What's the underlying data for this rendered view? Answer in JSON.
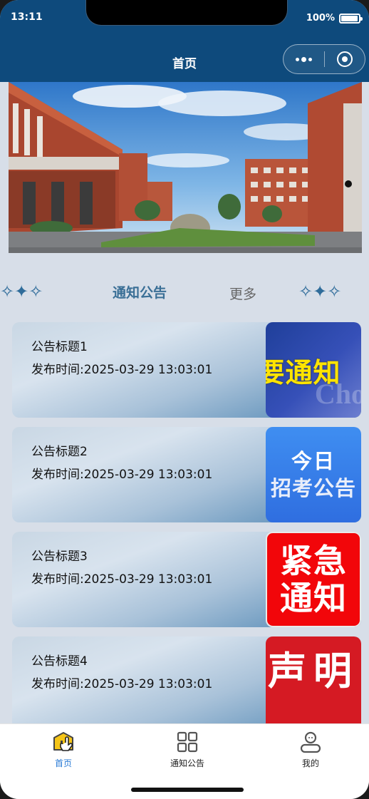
{
  "status_bar": {
    "time": "13:11",
    "battery": "100%"
  },
  "nav": {
    "title": "首页"
  },
  "capsule": {
    "more_icon": "more-dots-icon",
    "close_icon": "target-circle-icon"
  },
  "section": {
    "title": "通知公告",
    "more": "更多",
    "star_left": "✧✦✧",
    "star_right": "✧✦✧"
  },
  "notices": [
    {
      "title": "公告标题1",
      "time": "发布时间:2025-03-29 13:03:01",
      "thumb_text": [
        "要通知"
      ],
      "thumb_deco": "Cho"
    },
    {
      "title": "公告标题2",
      "time": "发布时间:2025-03-29 13:03:01",
      "thumb_text": [
        "今日",
        "招考公告"
      ]
    },
    {
      "title": "公告标题3",
      "time": "发布时间:2025-03-29 13:03:01",
      "thumb_text": [
        "紧急",
        "通知"
      ]
    },
    {
      "title": "公告标题4",
      "time": "发布时间:2025-03-29 13:03:01",
      "thumb_text": [
        "声明"
      ]
    }
  ],
  "tabs": [
    {
      "label": "首页",
      "icon": "home-icon",
      "active": true
    },
    {
      "label": "通知公告",
      "icon": "grid-icon",
      "active": false
    },
    {
      "label": "我的",
      "icon": "user-icon",
      "active": false
    }
  ],
  "colors": {
    "header": "#0e4a7c",
    "accent": "#2a7bd6",
    "page_bg": "#d7dee8"
  }
}
